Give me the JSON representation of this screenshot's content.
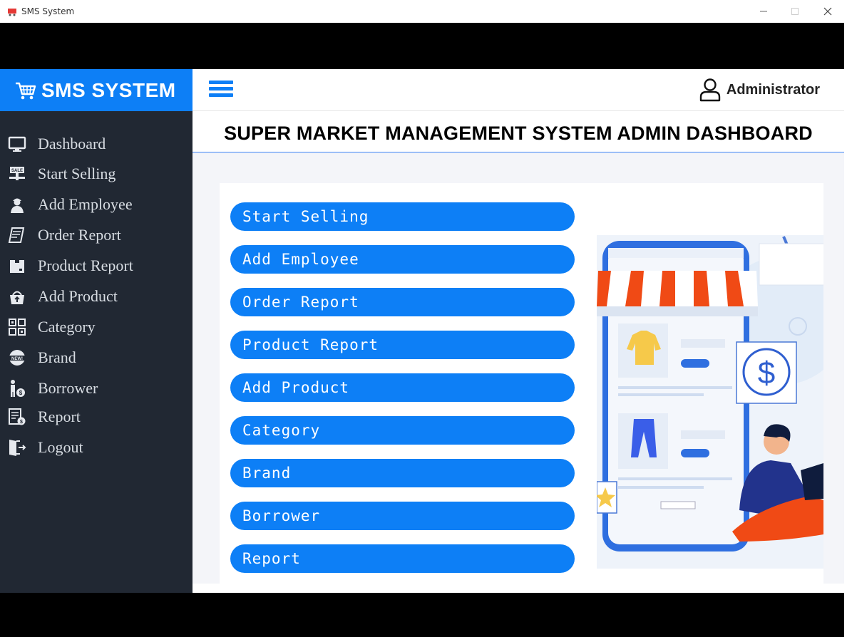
{
  "window": {
    "title": "SMS System"
  },
  "brand": {
    "name": "SMS SYSTEM"
  },
  "topbar": {
    "user_name": "Administrator"
  },
  "page": {
    "title": "SUPER MARKET MANAGEMENT SYSTEM ADMIN DASHBOARD"
  },
  "sidebar": {
    "items": [
      {
        "label": "Dashboard",
        "icon": "monitor-icon"
      },
      {
        "label": "Start Selling",
        "icon": "sale-sign-icon"
      },
      {
        "label": "Add Employee",
        "icon": "employee-icon"
      },
      {
        "label": "Order Report",
        "icon": "order-report-icon"
      },
      {
        "label": "Product Report",
        "icon": "product-box-icon"
      },
      {
        "label": "Add Product",
        "icon": "add-product-icon"
      },
      {
        "label": "Category",
        "icon": "category-grid-icon"
      },
      {
        "label": "Brand",
        "icon": "new-badge-icon"
      },
      {
        "label": "Borrower",
        "icon": "borrower-icon"
      },
      {
        "label": "Report",
        "icon": "report-icon"
      },
      {
        "label": "Logout",
        "icon": "logout-door-icon"
      }
    ]
  },
  "menu_buttons": [
    "Start Selling",
    "Add Employee",
    "Order Report",
    "Product Report",
    "Add Product",
    "Category",
    "Brand",
    "Borrower",
    "Report"
  ],
  "colors": {
    "accent": "#0d7ff6",
    "sidebar_bg": "#212833",
    "sidebar_text": "#d8dde3",
    "content_bg": "#f4f5f9"
  }
}
